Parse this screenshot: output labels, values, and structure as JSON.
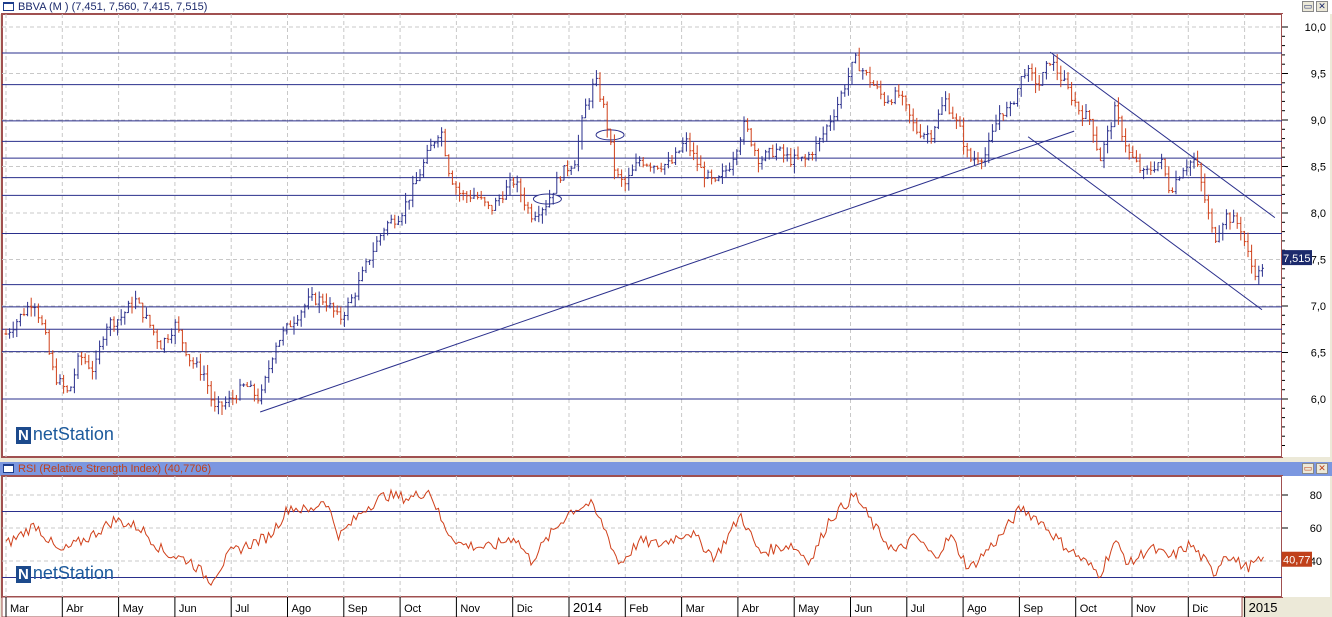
{
  "main_panel": {
    "title": "BBVA (M ) (7,451, 7,560, 7,415, 7,515)",
    "last_price_label": "7,515",
    "logo": "netStation"
  },
  "rsi_panel": {
    "title": "RSI (Relative Strength Index) (40,7706)",
    "last_value_label": "40,77",
    "logo": "netStation"
  },
  "colors": {
    "up": "#2a2f8c",
    "down": "#d0401a",
    "rsi_line": "#d0401a",
    "lines": "#2a2f8c",
    "border": "#a05050",
    "label_bg": "#1c2a6c",
    "rsi_label_bg": "#c0401a"
  },
  "icons": [
    "window-icon",
    "maximize-icon",
    "close-icon"
  ],
  "chart_data": [
    {
      "type": "ohlc",
      "title": "BBVA (M ) (7,451, 7,560, 7,415, 7,515)",
      "ylim": [
        5.45,
        10.15
      ],
      "grid": true,
      "y_ticks": [
        "10,0",
        "9,5",
        "9,0",
        "8,5",
        "8,0",
        "7,5",
        "7,0",
        "6,5",
        "6,0"
      ],
      "x_ticks": [
        "Mar",
        "Abr",
        "May",
        "Jun",
        "Jul",
        "Ago",
        "Sep",
        "Oct",
        "Nov",
        "Dic",
        "2014",
        "Feb",
        "Mar",
        "Abr",
        "May",
        "Jun",
        "Jul",
        "Ago",
        "Sep",
        "Oct",
        "Nov",
        "Dic",
        "2015"
      ],
      "closes": [
        [
          "2013-03-01",
          6.7
        ],
        [
          "2013-03-08",
          6.87
        ],
        [
          "2013-03-16",
          7.07
        ],
        [
          "2013-03-22",
          6.7
        ],
        [
          "2013-03-27",
          6.26
        ],
        [
          "2013-04-04",
          6.05
        ],
        [
          "2013-04-10",
          6.47
        ],
        [
          "2013-04-18",
          6.3
        ],
        [
          "2013-04-24",
          6.8
        ],
        [
          "2013-05-02",
          6.87
        ],
        [
          "2013-05-10",
          7.07
        ],
        [
          "2013-05-18",
          6.8
        ],
        [
          "2013-05-24",
          6.58
        ],
        [
          "2013-06-01",
          6.8
        ],
        [
          "2013-06-09",
          6.42
        ],
        [
          "2013-06-17",
          6.26
        ],
        [
          "2013-06-22",
          5.88
        ],
        [
          "2013-07-01",
          5.99
        ],
        [
          "2013-07-09",
          6.15
        ],
        [
          "2013-07-17",
          5.99
        ],
        [
          "2013-07-25",
          6.58
        ],
        [
          "2013-08-02",
          6.8
        ],
        [
          "2013-08-13",
          7.07
        ],
        [
          "2013-08-21",
          7.07
        ],
        [
          "2013-08-29",
          6.85
        ],
        [
          "2013-09-06",
          7.12
        ],
        [
          "2013-09-15",
          7.55
        ],
        [
          "2013-09-23",
          7.87
        ],
        [
          "2013-10-01",
          7.98
        ],
        [
          "2013-10-09",
          8.3
        ],
        [
          "2013-10-17",
          8.68
        ],
        [
          "2013-10-23",
          8.92
        ],
        [
          "2013-10-28",
          8.41
        ],
        [
          "2013-11-03",
          8.19
        ],
        [
          "2013-11-11",
          8.19
        ],
        [
          "2013-11-19",
          8.03
        ],
        [
          "2013-11-27",
          8.24
        ],
        [
          "2013-12-02",
          8.35
        ],
        [
          "2013-12-11",
          7.98
        ],
        [
          "2013-12-19",
          8.09
        ],
        [
          "2013-12-27",
          8.41
        ],
        [
          "2014-01-04",
          8.57
        ],
        [
          "2014-01-09",
          9.1
        ],
        [
          "2014-01-15",
          9.43
        ],
        [
          "2014-01-20",
          9.1
        ],
        [
          "2014-01-26",
          8.41
        ],
        [
          "2014-01-31",
          8.3
        ],
        [
          "2014-02-08",
          8.57
        ],
        [
          "2014-02-16",
          8.52
        ],
        [
          "2014-02-25",
          8.52
        ],
        [
          "2014-03-05",
          8.78
        ],
        [
          "2014-03-13",
          8.47
        ],
        [
          "2014-03-21",
          8.3
        ],
        [
          "2014-03-29",
          8.52
        ],
        [
          "2014-04-06",
          8.95
        ],
        [
          "2014-04-14",
          8.57
        ],
        [
          "2014-04-23",
          8.68
        ],
        [
          "2014-05-01",
          8.57
        ],
        [
          "2014-05-09",
          8.57
        ],
        [
          "2014-05-17",
          8.78
        ],
        [
          "2014-05-25",
          9.1
        ],
        [
          "2014-06-05",
          9.65
        ],
        [
          "2014-06-13",
          9.43
        ],
        [
          "2014-06-21",
          9.22
        ],
        [
          "2014-06-29",
          9.27
        ],
        [
          "2014-07-08",
          8.89
        ],
        [
          "2014-07-16",
          8.84
        ],
        [
          "2014-07-24",
          9.22
        ],
        [
          "2014-08-01",
          8.89
        ],
        [
          "2014-08-06",
          8.57
        ],
        [
          "2014-08-15",
          8.63
        ],
        [
          "2014-08-23",
          9.1
        ],
        [
          "2014-08-28",
          9.1
        ],
        [
          "2014-09-05",
          9.54
        ],
        [
          "2014-09-13",
          9.38
        ],
        [
          "2014-09-19",
          9.65
        ],
        [
          "2014-09-27",
          9.38
        ],
        [
          "2014-10-05",
          9.1
        ],
        [
          "2014-10-11",
          9.0
        ],
        [
          "2014-10-16",
          8.57
        ],
        [
          "2014-10-24",
          9.1
        ],
        [
          "2014-11-01",
          8.63
        ],
        [
          "2014-11-09",
          8.41
        ],
        [
          "2014-11-18",
          8.57
        ],
        [
          "2014-11-23",
          8.24
        ],
        [
          "2014-12-01",
          8.52
        ],
        [
          "2014-12-07",
          8.57
        ],
        [
          "2014-12-12",
          8.14
        ],
        [
          "2014-12-17",
          7.71
        ],
        [
          "2014-12-23",
          7.98
        ],
        [
          "2014-12-31",
          7.87
        ],
        [
          "2015-01-06",
          7.44
        ],
        [
          "2015-01-10",
          7.33
        ],
        [
          "2015-01-14",
          7.52
        ]
      ],
      "horizontal_levels": [
        9.72,
        9.38,
        8.99,
        8.77,
        8.59,
        8.38,
        8.19,
        7.78,
        7.23,
        6.99,
        6.75,
        6.51,
        6.0
      ],
      "trendlines": [
        [
          [
            "2013-07-17",
            5.86
          ],
          [
            "2014-10-02",
            8.88
          ]
        ],
        [
          [
            "2014-09-19",
            9.73
          ],
          [
            "2015-01-19",
            7.95
          ]
        ],
        [
          [
            "2014-09-07",
            8.82
          ],
          [
            "2015-01-12",
            6.96
          ]
        ]
      ],
      "ellipses": [
        [
          "2013-12-20",
          8.15
        ],
        [
          "2014-01-23",
          8.84
        ]
      ]
    },
    {
      "type": "line",
      "title": "RSI (Relative Strength Index) (40,7706)",
      "ylim": [
        20,
        90
      ],
      "y_ticks": [
        "80",
        "60",
        "40"
      ],
      "levels": [
        70,
        30
      ],
      "values": [
        [
          "2013-03-01",
          50
        ],
        [
          "2013-03-17",
          62
        ],
        [
          "2013-03-30",
          45
        ],
        [
          "2013-04-16",
          55
        ],
        [
          "2013-04-29",
          65
        ],
        [
          "2013-05-13",
          60
        ],
        [
          "2013-05-26",
          45
        ],
        [
          "2013-06-09",
          40
        ],
        [
          "2013-06-20",
          28
        ],
        [
          "2013-07-01",
          45
        ],
        [
          "2013-07-11",
          50
        ],
        [
          "2013-07-22",
          55
        ],
        [
          "2013-08-02",
          73
        ],
        [
          "2013-08-13",
          70
        ],
        [
          "2013-08-21",
          78
        ],
        [
          "2013-08-29",
          55
        ],
        [
          "2013-09-12",
          72
        ],
        [
          "2013-09-23",
          80
        ],
        [
          "2013-10-06",
          78
        ],
        [
          "2013-10-17",
          83
        ],
        [
          "2013-10-25",
          60
        ],
        [
          "2013-11-03",
          50
        ],
        [
          "2013-11-19",
          48
        ],
        [
          "2013-12-02",
          55
        ],
        [
          "2013-12-11",
          40
        ],
        [
          "2013-12-21",
          55
        ],
        [
          "2014-01-01",
          70
        ],
        [
          "2014-01-12",
          75
        ],
        [
          "2014-01-20",
          60
        ],
        [
          "2014-01-28",
          38
        ],
        [
          "2014-02-08",
          52
        ],
        [
          "2014-02-19",
          50
        ],
        [
          "2014-03-07",
          58
        ],
        [
          "2014-03-21",
          42
        ],
        [
          "2014-04-04",
          68
        ],
        [
          "2014-04-14",
          45
        ],
        [
          "2014-05-01",
          50
        ],
        [
          "2014-05-12",
          40
        ],
        [
          "2014-05-22",
          65
        ],
        [
          "2014-06-05",
          80
        ],
        [
          "2014-06-16",
          60
        ],
        [
          "2014-06-27",
          45
        ],
        [
          "2014-07-08",
          55
        ],
        [
          "2014-07-18",
          42
        ],
        [
          "2014-07-27",
          55
        ],
        [
          "2014-08-06",
          35
        ],
        [
          "2014-08-17",
          48
        ],
        [
          "2014-08-23",
          55
        ],
        [
          "2014-09-03",
          72
        ],
        [
          "2014-09-13",
          65
        ],
        [
          "2014-09-24",
          52
        ],
        [
          "2014-10-05",
          42
        ],
        [
          "2014-10-16",
          32
        ],
        [
          "2014-10-24",
          52
        ],
        [
          "2014-11-01",
          38
        ],
        [
          "2014-11-12",
          48
        ],
        [
          "2014-11-23",
          42
        ],
        [
          "2014-12-04",
          50
        ],
        [
          "2014-12-12",
          40
        ],
        [
          "2014-12-17",
          32
        ],
        [
          "2014-12-23",
          45
        ],
        [
          "2015-01-03",
          36
        ],
        [
          "2015-01-14",
          41
        ]
      ]
    }
  ]
}
